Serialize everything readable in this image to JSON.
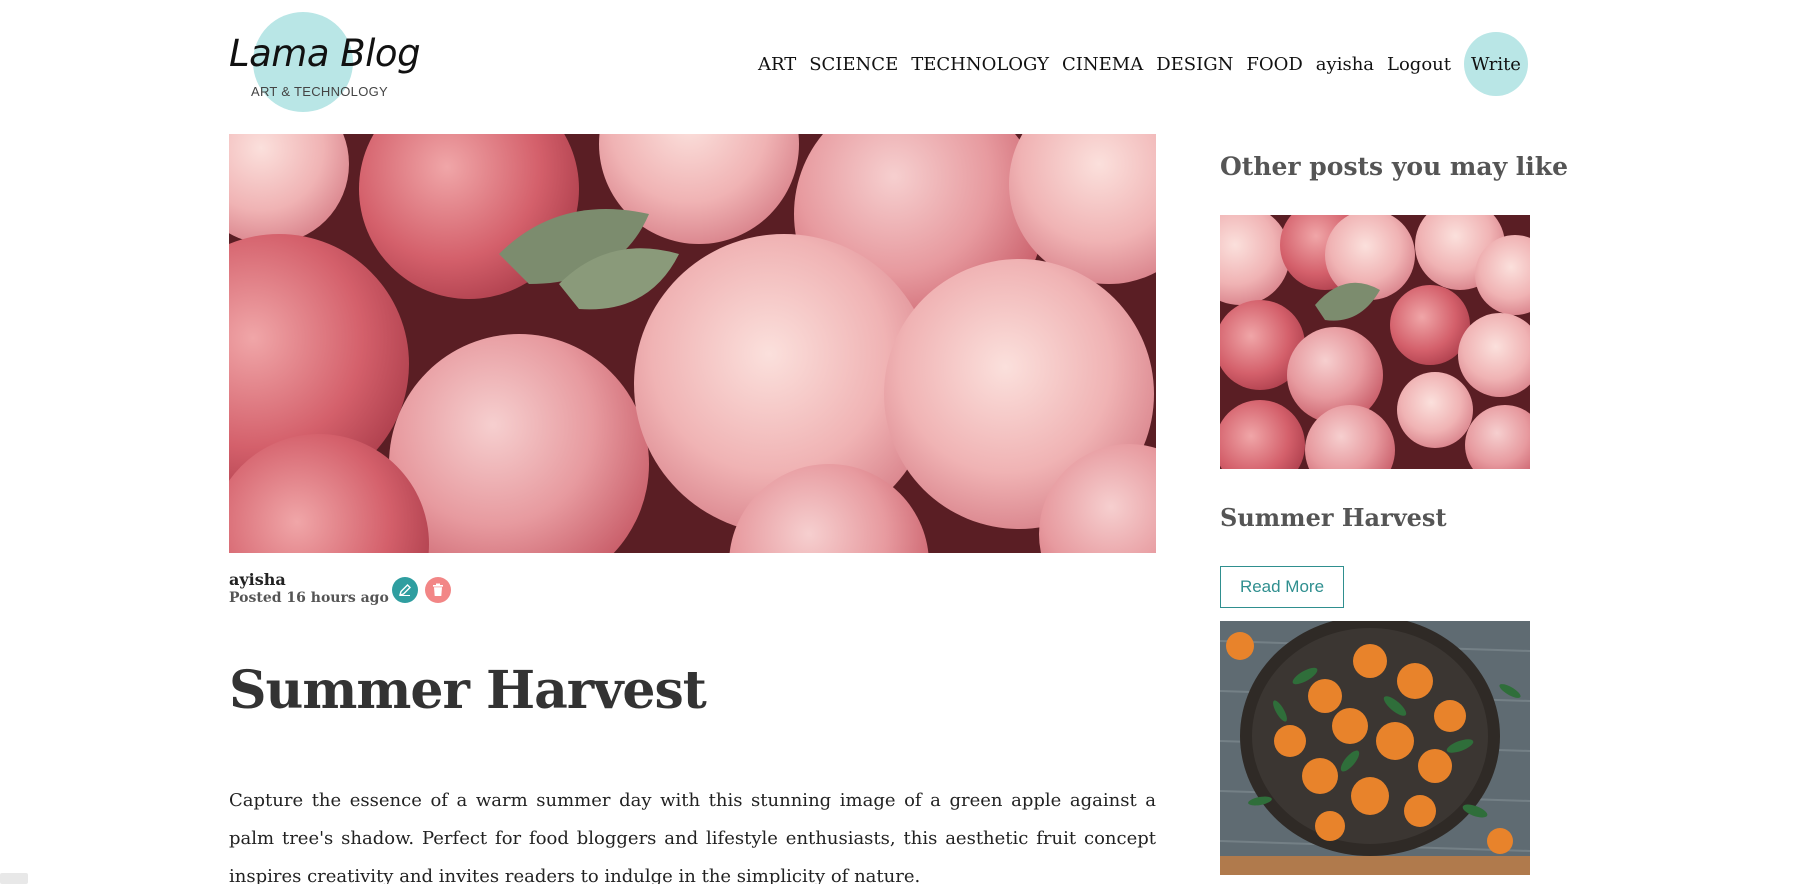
{
  "logo": {
    "title": "Lama Blog",
    "subtitle": "ART & TECHNOLOGY"
  },
  "nav": {
    "links": [
      "ART",
      "SCIENCE",
      "TECHNOLOGY",
      "CINEMA",
      "DESIGN",
      "FOOD"
    ],
    "user": "ayisha",
    "logout": "Logout",
    "write": "Write"
  },
  "post": {
    "image": "peaches-photo",
    "author": "ayisha",
    "posted": "Posted 16 hours ago",
    "title": "Summer Harvest",
    "body": "Capture the essence of a warm summer day with this stunning image of a green apple against a palm tree's shadow. Perfect for food bloggers and lifestyle enthusiasts, this aesthetic fruit concept inspires creativity and invites readers to indulge in the simplicity of nature."
  },
  "sidebar": {
    "heading": "Other posts you may like",
    "posts": [
      {
        "image": "peaches-photo",
        "title": "Summer Harvest",
        "button": "Read More"
      },
      {
        "image": "oranges-bowl-photo"
      }
    ]
  },
  "colors": {
    "accent": "#b9e6e6",
    "teal": "#2f9ea0",
    "delete": "#f28686",
    "peach": "#e89aa1"
  }
}
